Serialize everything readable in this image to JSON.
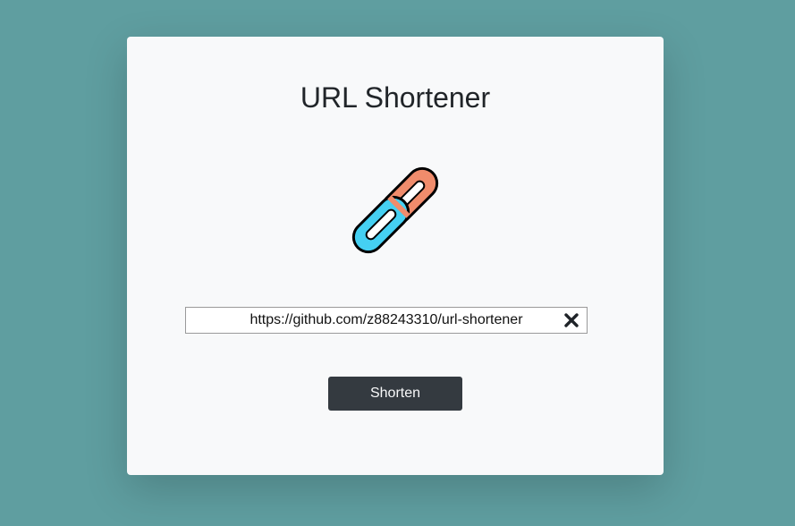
{
  "page": {
    "title": "URL Shortener"
  },
  "logo": {
    "icon": "chain-link-icon",
    "colors": {
      "left_link": "#45d0f2",
      "right_link": "#f08c6c",
      "outline": "#000000"
    }
  },
  "form": {
    "url_value": "https://github.com/z88243310/url-shortener",
    "url_placeholder": "",
    "clear_icon": "close-icon",
    "submit_label": "Shorten"
  },
  "colors": {
    "background": "#5f9ea0",
    "card": "#f8f9fa",
    "button": "#343a40"
  }
}
